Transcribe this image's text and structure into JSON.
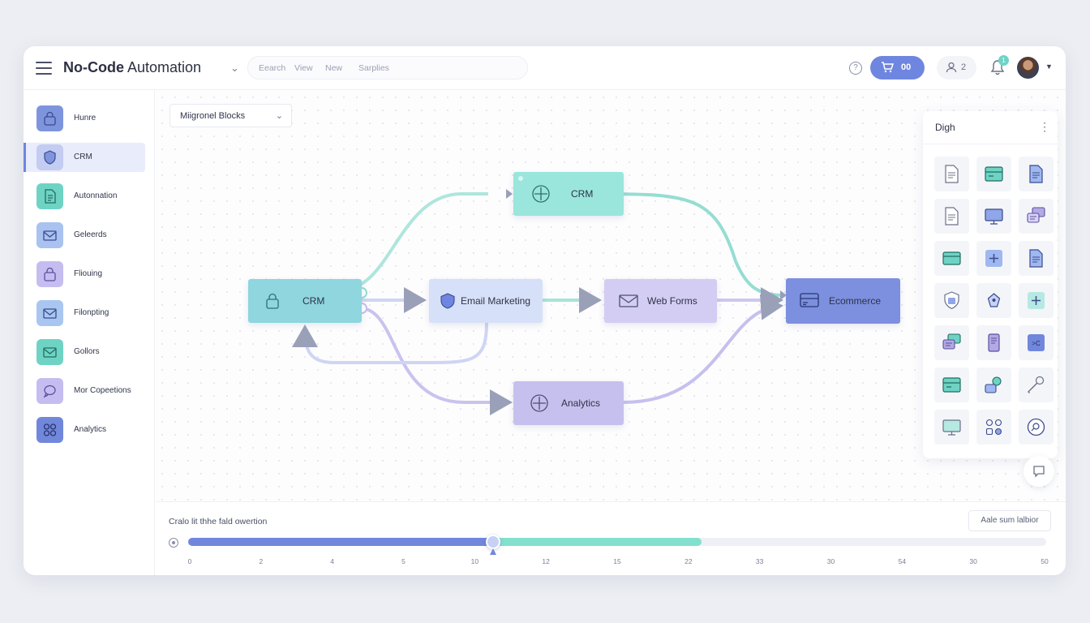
{
  "header": {
    "title_bold": "No-Code",
    "title_rest": " Automation",
    "search_tabs": [
      "Eearch",
      "View",
      "New",
      "Sarplies"
    ],
    "cart_label": "00",
    "user_count": "2",
    "notification_count": "1"
  },
  "sidebar": {
    "items": [
      {
        "label": "Hunre",
        "icon": "lock-icon",
        "color": "#7e95de"
      },
      {
        "label": "CRM",
        "icon": "shield-icon",
        "color": "#9aaae6",
        "active": true
      },
      {
        "label": "Autonnation",
        "icon": "document-icon",
        "color": "#6fd3c4"
      },
      {
        "label": "Geleerds",
        "icon": "mail-icon",
        "color": "#8fb0ec"
      },
      {
        "label": "Fliouing",
        "icon": "lock-icon",
        "color": "#b3a9e3"
      },
      {
        "label": "Filonpting",
        "icon": "mail-icon",
        "color": "#8fb6ec"
      },
      {
        "label": "Gollors",
        "icon": "mail-icon",
        "color": "#6fd3c4"
      },
      {
        "label": "Mor Copeetions",
        "icon": "chat-icon",
        "color": "#b3a9e3"
      },
      {
        "label": "Analytics",
        "icon": "grid-icon",
        "color": "#7187dc"
      }
    ]
  },
  "canvas": {
    "block_select": "Miigronel Blocks",
    "nodes": {
      "crm_left": "CRM",
      "crm_top": "CRM",
      "email": "Email Marketing",
      "webforms": "Web Forms",
      "analytics": "Analytics",
      "ecommerce": "Ecommerce"
    }
  },
  "palette": {
    "title": "Digh",
    "tiles": [
      "document-icon",
      "card-icon",
      "document-icon",
      "document-icon",
      "monitor-icon",
      "chat-icon",
      "card-icon",
      "plus-icon",
      "document-icon",
      "shield-icon",
      "tag-icon",
      "plus-icon",
      "chat-icon",
      "phone-icon",
      "code-icon",
      "card-icon",
      "cloud-icon",
      "key-icon",
      "monitor-icon",
      "grid-icon",
      "search-icon"
    ]
  },
  "timeline": {
    "label": "Cralo lit thhe fald owertion",
    "action_button": "Aale sum lalbior",
    "ticks": [
      "0",
      "2",
      "4",
      "5",
      "10",
      "12",
      "15",
      "22",
      "33",
      "30",
      "54",
      "30",
      "50"
    ],
    "progress_primary": 0.355,
    "progress_secondary": 0.598
  },
  "colors": {
    "accent": "#6f86e0",
    "teal": "#83e0cf",
    "lavender": "#c9c4ef"
  }
}
